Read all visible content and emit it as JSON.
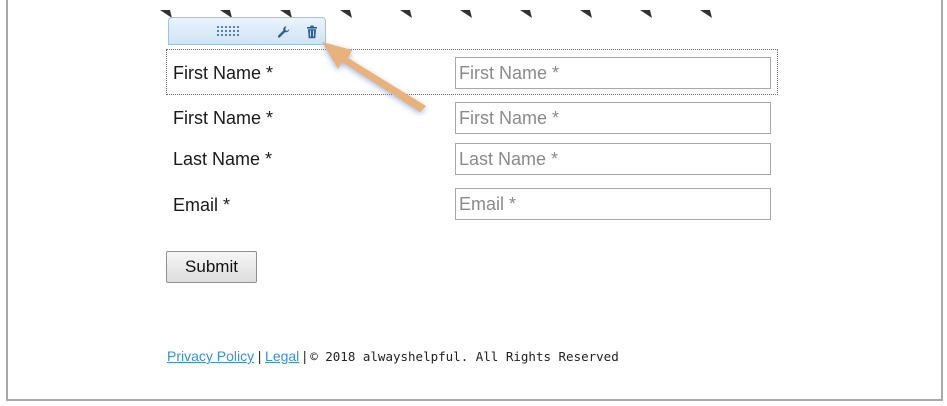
{
  "toolbar": {
    "icons": [
      "drag-handle-icon",
      "wrench-icon",
      "trash-icon"
    ]
  },
  "form": {
    "rows": [
      {
        "label": "First Name *",
        "placeholder": "First Name *"
      },
      {
        "label": "First Name *",
        "placeholder": "First Name *"
      },
      {
        "label": "Last Name *",
        "placeholder": "Last Name *"
      },
      {
        "label": "Email *",
        "placeholder": "Email *"
      }
    ],
    "submit_label": "Submit"
  },
  "footer": {
    "privacy_link": "Privacy Policy",
    "separator": "|",
    "legal_link": "Legal",
    "copyright": "© 2018 alwayshelpful. All Rights Reserved"
  },
  "colors": {
    "link": "#3d8fd8",
    "toolbar_bg": "#cfe3f6",
    "arrow": "#e8b27a"
  }
}
